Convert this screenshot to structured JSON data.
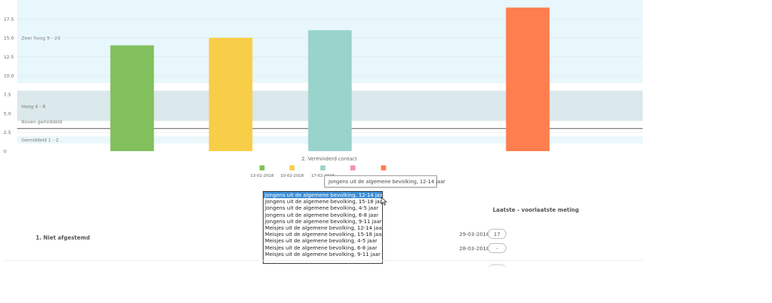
{
  "chart_data": {
    "type": "bar",
    "title": "2. Verminderd contact",
    "ylim": [
      0,
      19
    ],
    "yticks": [
      0,
      2.5,
      5.0,
      7.5,
      10.0,
      12.5,
      15.0,
      17.5
    ],
    "ytick_labels": [
      "0",
      "2.5",
      "5.0",
      "7.5",
      "10.0",
      "12.5",
      "15.0",
      "17.5"
    ],
    "bands": [
      {
        "label": "Zeer hoog 9 - 24",
        "from": 9,
        "to": 24,
        "color": "#e8f7fb"
      },
      {
        "label": "Hoog 4 - 8",
        "from": 4,
        "to": 8,
        "color": "#dbe8ec"
      },
      {
        "label": "Gemiddeld 1 - 2",
        "from": 1,
        "to": 2,
        "color": "#eaf7fb"
      }
    ],
    "reference_line": {
      "label": "Boven gemiddeld",
      "value": 3
    },
    "series": [
      {
        "name": "13-01-2018",
        "value": 14,
        "color": "#82bf5d"
      },
      {
        "name": "10-02-2018",
        "value": 15,
        "color": "#f8cd48"
      },
      {
        "name": "17-02-2018",
        "value": 16,
        "color": "#98d3cc"
      },
      {
        "name": "",
        "value": null,
        "color": "#f08fbd"
      },
      {
        "name": "",
        "value": 19,
        "color": "#fd7e4f"
      }
    ],
    "legend": "bottom",
    "grid": true
  },
  "tooltip": {
    "text": "Jongens uit de algemene bevolking, 12-14 jaar"
  },
  "dropdown": {
    "options": [
      "Jongens uit de algemene bevolking, 12-14 jaar",
      "Jongens uit de algemene bevolking, 15-18 jaar",
      "Jongens uit de algemene bevolking, 4-5 jaar",
      "Jongens uit de algemene bevolking, 6-8 jaar",
      "Jongens uit de algemene bevolking, 9-11 jaar",
      "Meisjes uit de algemene bevolking, 12-14 jaar",
      "Meisjes uit de algemene bevolking, 15-18 jaar",
      "Meisjes uit de algemene bevolking, 4-5 jaar",
      "Meisjes uit de algemene bevolking, 6-8 jaar",
      "Meisjes uit de algemene bevolking, 9-11 jaar"
    ],
    "selected_index": 0
  },
  "section": {
    "item_label": "1. Niet afgestemd",
    "meting_title": "Laatste - voorlaatste meting",
    "measurements": [
      {
        "date": "29-03-2018",
        "value": "17"
      },
      {
        "date": "28-03-2018",
        "value": "-"
      }
    ]
  }
}
